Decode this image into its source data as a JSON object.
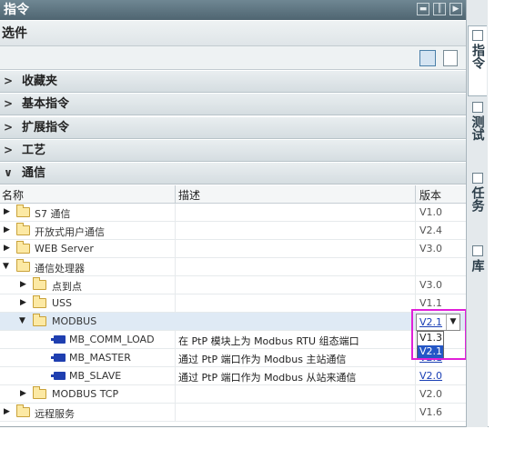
{
  "panel_title": "指令",
  "options_label": "选件",
  "sections": [
    {
      "label": "收藏夹",
      "expanded": false
    },
    {
      "label": "基本指令",
      "expanded": false
    },
    {
      "label": "扩展指令",
      "expanded": false
    },
    {
      "label": "工艺",
      "expanded": false
    },
    {
      "label": "通信",
      "expanded": true
    }
  ],
  "columns": {
    "name": "名称",
    "description": "描述",
    "version": "版本"
  },
  "rows": [
    {
      "name": "S7 通信",
      "description": "",
      "version": "V1.0"
    },
    {
      "name": "开放式用户通信",
      "description": "",
      "version": "V2.4"
    },
    {
      "name": "WEB Server",
      "description": "",
      "version": "V3.0"
    },
    {
      "name": "通信处理器",
      "description": "",
      "version": ""
    },
    {
      "name": "点到点",
      "description": "",
      "version": "V3.0"
    },
    {
      "name": "USS",
      "description": "",
      "version": "V1.1"
    },
    {
      "name": "MODBUS",
      "description": "",
      "version": "V2.1"
    },
    {
      "name": "MB_COMM_LOAD",
      "description": "在 PtP 模块上为 Modbus RTU 组态端口",
      "version": ""
    },
    {
      "name": "MB_MASTER",
      "description": "通过 PtP 端口作为 Modbus 主站通信",
      "version": "V2.1"
    },
    {
      "name": "MB_SLAVE",
      "description": "通过 PtP 端口作为 Modbus 从站来通信",
      "version": "V2.0"
    },
    {
      "name": "MODBUS TCP",
      "description": "",
      "version": "V2.0"
    },
    {
      "name": "远程服务",
      "description": "",
      "version": "V1.6"
    }
  ],
  "version_dropdown": {
    "selected": "V2.1",
    "options": [
      "V1.3",
      "V2.1"
    ],
    "highlighted": "V2.1"
  },
  "side_tabs": [
    "指令",
    "测试",
    "任务",
    "库"
  ],
  "colors": {
    "highlight_box": "#e020d8",
    "selection": "#2457c6",
    "link": "#1a3fb5"
  }
}
